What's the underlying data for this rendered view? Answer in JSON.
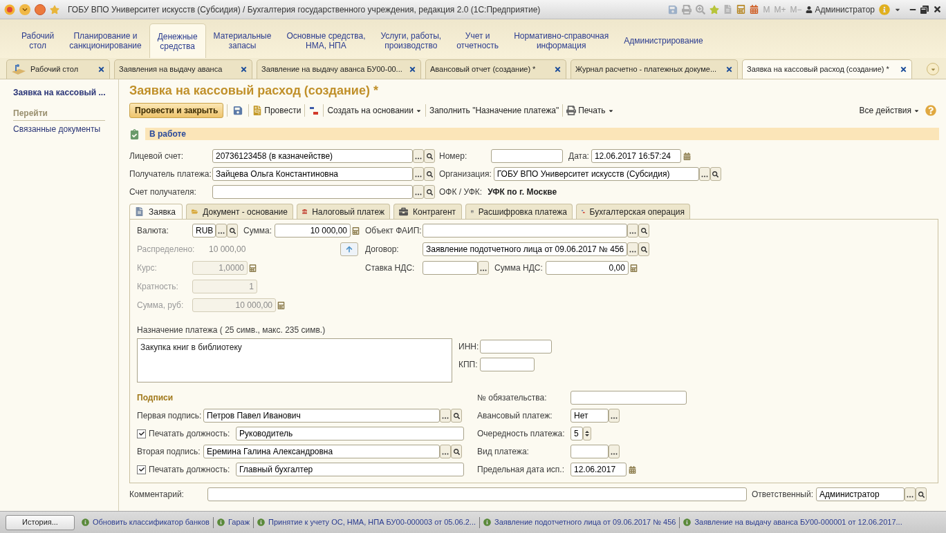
{
  "window": {
    "title": "ГОБУ ВПО Университет искусств (Субсидия) / Бухгалтерия государственного учреждения, редакция 2.0  (1С:Предприятие)",
    "memory_buttons": [
      "M",
      "M+",
      "M−"
    ],
    "user": "Администратор"
  },
  "sections": [
    {
      "lines": [
        "Рабочий",
        "стол"
      ],
      "selected": false
    },
    {
      "lines": [
        "Планирование и",
        "санкционирование"
      ],
      "selected": false
    },
    {
      "lines": [
        "Денежные",
        "средства"
      ],
      "selected": true
    },
    {
      "lines": [
        "Материальные",
        "запасы"
      ],
      "selected": false
    },
    {
      "lines": [
        "Основные средства,",
        "НМА, НПА"
      ],
      "selected": false
    },
    {
      "lines": [
        "Услуги, работы,",
        "производство"
      ],
      "selected": false
    },
    {
      "lines": [
        "Учет и",
        "отчетность"
      ],
      "selected": false
    },
    {
      "lines": [
        "Нормативно-справочная",
        "информация"
      ],
      "selected": false
    },
    {
      "lines": [
        "Администрирование"
      ],
      "selected": false
    }
  ],
  "open_tabs": [
    {
      "label": "Рабочий стол",
      "selected": false,
      "kind": "home"
    },
    {
      "label": "Заявления на выдачу аванса",
      "selected": false,
      "kind": "plain"
    },
    {
      "label": "Заявление на выдачу аванса БУ00-00...",
      "selected": false,
      "kind": "plain"
    },
    {
      "label": "Авансовый отчет (создание) *",
      "selected": false,
      "kind": "plain"
    },
    {
      "label": "Журнал расчетно - платежных докуме...",
      "selected": false,
      "kind": "plain"
    },
    {
      "label": "Заявка на кассовый расход (создание) *",
      "selected": true,
      "kind": "plain"
    }
  ],
  "sidebar": {
    "title": "Заявка на кассовый ...",
    "group": "Перейти",
    "links": [
      "Связанные документы"
    ]
  },
  "form": {
    "title": "Заявка на кассовый расход (создание) *",
    "commands": [
      {
        "kind": "primary",
        "label": "Провести и закрыть"
      },
      {
        "kind": "save"
      },
      {
        "kind": "post",
        "label": "Провести"
      },
      {
        "kind": "dtkt"
      },
      {
        "kind": "menu",
        "label": "Создать на основании"
      },
      {
        "kind": "plain",
        "label": "Заполнить \"Назначение платежа\""
      },
      {
        "kind": "print",
        "label": "Печать"
      }
    ],
    "all_actions": "Все действия",
    "status": "В работе",
    "header": {
      "account": {
        "label": "Лицевой счет:",
        "value": "20736123458 (в казначействе)",
        "kind": "ref"
      },
      "payee": {
        "label": "Получатель платежа:",
        "value": "Зайцева Ольга Константиновна",
        "kind": "ref"
      },
      "payee_account": {
        "label": "Счет получателя:",
        "kind": "ref"
      },
      "number": {
        "label": "Номер:"
      },
      "date": {
        "label": "Дата:",
        "value": "12.06.2017 16:57:24",
        "kind": "date"
      },
      "organization": {
        "label": "Организация:",
        "value": "ГОБУ ВПО Университет искусств (Субсидия)",
        "kind": "ref"
      },
      "ofk": {
        "label": "ОФК / УФК:",
        "value": "УФК по г. Москве"
      }
    },
    "tabs": [
      {
        "label": "Заявка",
        "selected": true,
        "kind": "doc"
      },
      {
        "label": "Документ - основание",
        "selected": false,
        "kind": "folder"
      },
      {
        "label": "Налоговый платеж",
        "selected": false,
        "kind": "tax"
      },
      {
        "label": "Контрагент",
        "selected": false,
        "kind": "briefcase"
      },
      {
        "label": "Расшифровка платежа",
        "selected": false,
        "kind": "table"
      },
      {
        "label": "Бухгалтерская операция",
        "selected": false,
        "kind": "dtkt"
      }
    ],
    "request": {
      "currency": {
        "label": "Валюта:",
        "value": "RUB",
        "kind": "ref"
      },
      "amount": {
        "label": "Сумма:",
        "value": "10 000,00",
        "kind": "number"
      },
      "distributed": {
        "label": "Распределено:",
        "value": "10 000,00"
      },
      "rate": {
        "label": "Курс:",
        "value": "1,0000",
        "kind": "number",
        "disabled": true
      },
      "multiplicity": {
        "label": "Кратность:",
        "value": "1",
        "disabled": true
      },
      "amount_rub": {
        "label": "Сумма, руб:",
        "value": "10 000,00",
        "kind": "number",
        "disabled": true
      },
      "faip": {
        "label": "Объект ФАИП:",
        "kind": "ref"
      },
      "contract": {
        "label": "Договор:",
        "value": "Заявление подотчетного лица от 09.06.2017 № 456",
        "kind": "ref"
      },
      "vat_rate": {
        "label": "Ставка НДС:",
        "kind": "choice"
      },
      "vat_amount": {
        "label": "Сумма НДС:",
        "value": "0,00",
        "kind": "number"
      },
      "purpose": {
        "label": "Назначение платежа ( 25 симв., макс. 235 симв.)",
        "value": "Закупка книг в библиотеку"
      },
      "inn": {
        "label": "ИНН:"
      },
      "kpp": {
        "label": "КПП:"
      },
      "signatures": {
        "heading": "Подписи",
        "rows": [
          {
            "kind": "signer",
            "label": "Первая подпись:",
            "value": "Петров Павел Иванович"
          },
          {
            "kind": "position",
            "checked": true,
            "label": "Печатать должность:",
            "value": "Руководитель"
          },
          {
            "kind": "signer",
            "label": "Вторая подпись:",
            "value": "Еремина Галина Александровна"
          },
          {
            "kind": "position",
            "checked": true,
            "label": "Печатать должность:",
            "value": "Главный бухгалтер"
          }
        ]
      },
      "right": [
        {
          "label": "№ обязательства:"
        },
        {
          "label": "Авансовый платеж:",
          "value": "Нет",
          "kind": "choice"
        },
        {
          "label": "Очередность платежа:",
          "value": "5",
          "kind": "spin"
        },
        {
          "label": "Вид платежа:",
          "kind": "choice"
        },
        {
          "label": "Предельная дата исп.:",
          "value": "12.06.2017",
          "kind": "date"
        }
      ]
    },
    "comment": {
      "label": "Комментарий:"
    },
    "responsible": {
      "label": "Ответственный:",
      "value": "Администратор",
      "kind": "ref"
    }
  },
  "bottom": {
    "history": "История...",
    "links": [
      "Обновить классификатор банков",
      "Гараж",
      "Принятие к учету ОС, НМА, НПА БУ00-000003 от 05.06.2...",
      "Заявление подотчетного лица от 09.06.2017 № 456",
      "Заявление на выдачу аванса БУ00-000001 от 12.06.2017..."
    ]
  }
}
